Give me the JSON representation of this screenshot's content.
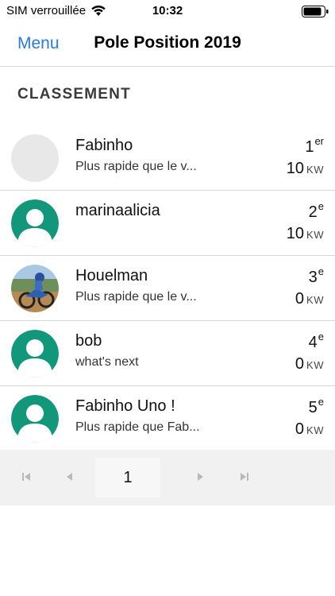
{
  "status_bar": {
    "carrier": "SIM verrouillée",
    "time": "10:32",
    "icons": [
      "wifi-icon",
      "battery-icon"
    ]
  },
  "nav": {
    "menu_label": "Menu",
    "title": "Pole Position 2019",
    "accent_color": "#2a7bd6"
  },
  "section": {
    "title": "CLASSEMENT"
  },
  "rows": [
    {
      "name": "Fabinho",
      "subtitle": "Plus rapide que le v...",
      "rank": "1",
      "rank_suffix": "er",
      "points": "10",
      "unit": "KW",
      "avatar": "placeholder"
    },
    {
      "name": "marinaalicia",
      "subtitle": "",
      "rank": "2",
      "rank_suffix": "e",
      "points": "10",
      "unit": "KW",
      "avatar": "default-user-icon"
    },
    {
      "name": "Houelman",
      "subtitle": "Plus rapide que le v...",
      "rank": "3",
      "rank_suffix": "e",
      "points": "0",
      "unit": "KW",
      "avatar": "photo"
    },
    {
      "name": "bob",
      "subtitle": "what's next",
      "rank": "4",
      "rank_suffix": "e",
      "points": "0",
      "unit": "KW",
      "avatar": "default-user-icon"
    },
    {
      "name": "Fabinho Uno !",
      "subtitle": "Plus rapide que Fab...",
      "rank": "5",
      "rank_suffix": "e",
      "points": "0",
      "unit": "KW",
      "avatar": "default-user-icon"
    }
  ],
  "pager": {
    "current_page": "1",
    "icons": [
      "first-page-icon",
      "prev-page-icon",
      "next-page-icon",
      "last-page-icon"
    ]
  },
  "colors": {
    "avatar_green": "#12977a",
    "divider": "#d7d7d7",
    "pager_bg": "#f1f1f1"
  }
}
